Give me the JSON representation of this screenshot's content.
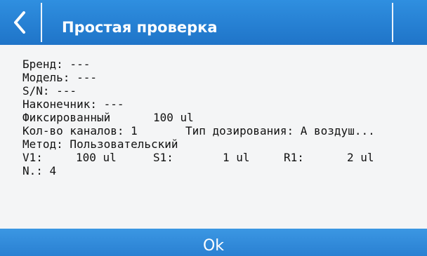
{
  "header": {
    "back_icon": "chevron-left-icon",
    "title": "Простая проверка"
  },
  "info": {
    "brand": "Бренд: ---",
    "model": "Модель: ---",
    "serial": "S/N: ---",
    "tip": "Наконечник: ---",
    "volume_type": "Фиксированный",
    "volume_value": "100 ul",
    "channels": "Кол-во каналов: 1",
    "dosing_type": "Тип дозирования: А воздуш...",
    "method": "Метод: Пользовательский",
    "v1_label": "V1:",
    "v1_value": "100 ul",
    "s1_label": "S1:",
    "s1_value": "1 ul",
    "r1_label": "R1:",
    "r1_value": "2 ul",
    "n": "N.: 4"
  },
  "footer": {
    "ok_label": "Ok"
  },
  "colors": {
    "header_blue": "#1f74c8",
    "background": "#f4f5f6",
    "text": "#111111"
  }
}
